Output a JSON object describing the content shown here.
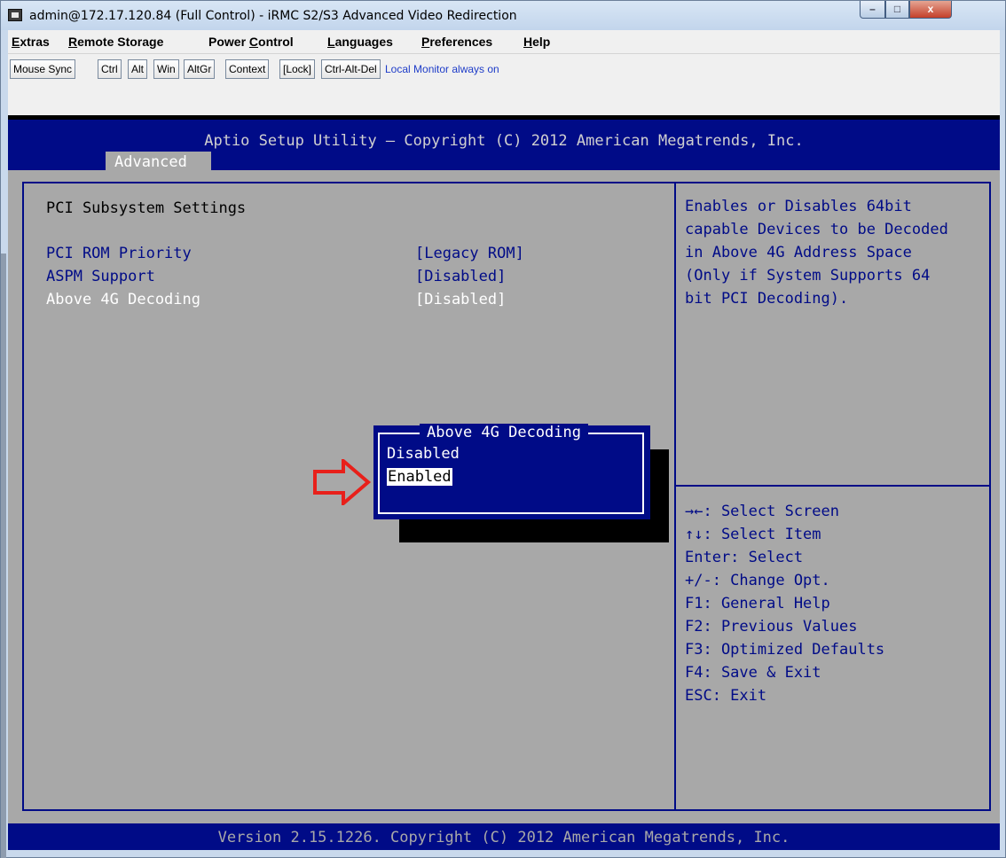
{
  "window": {
    "title": "admin@172.17.120.84 (Full Control) - iRMC S2/S3 Advanced Video Redirection",
    "controls": {
      "minimize": "–",
      "maximize": "□",
      "close": "x"
    }
  },
  "menubar": [
    {
      "label": "Extras",
      "u": "E"
    },
    {
      "label": "Remote Storage",
      "u": "R"
    },
    {
      "label": "Power Control",
      "u": "C"
    },
    {
      "label": "Languages",
      "u": "L"
    },
    {
      "label": "Preferences",
      "u": "P"
    },
    {
      "label": "Help",
      "u": "H"
    }
  ],
  "toolbar": {
    "buttons": [
      "Mouse Sync",
      "Ctrl",
      "Alt",
      "Win",
      "AltGr",
      "Context",
      "[Lock]",
      "Ctrl-Alt-Del"
    ],
    "info": "Local Monitor always on"
  },
  "bios": {
    "title": "Aptio Setup Utility – Copyright (C) 2012 American Megatrends, Inc.",
    "tab": "Advanced",
    "section_title": "PCI Subsystem Settings",
    "settings": [
      {
        "label": "PCI ROM Priority",
        "value": "[Legacy ROM]"
      },
      {
        "label": "ASPM Support",
        "value": "[Disabled]"
      },
      {
        "label": "Above 4G Decoding",
        "value": "[Disabled]"
      }
    ],
    "help_text": [
      "Enables or Disables 64bit",
      "capable Devices to be Decoded",
      "in Above 4G Address Space",
      "(Only if System Supports 64",
      "bit PCI Decoding)."
    ],
    "key_help": [
      "→←: Select Screen",
      "↑↓: Select Item",
      "Enter: Select",
      "+/-: Change Opt.",
      "F1: General Help",
      "F2: Previous Values",
      "F3: Optimized Defaults",
      "F4: Save & Exit",
      "ESC: Exit"
    ],
    "footer": "Version 2.15.1226. Copyright (C) 2012 American Megatrends, Inc.",
    "popup": {
      "title": "Above 4G Decoding",
      "options": [
        "Disabled",
        "Enabled"
      ],
      "selected": "Enabled"
    }
  },
  "colors": {
    "bios_blue": "#000b87",
    "bios_gray": "#a8a8a8",
    "arrow_red": "#e8201a"
  }
}
